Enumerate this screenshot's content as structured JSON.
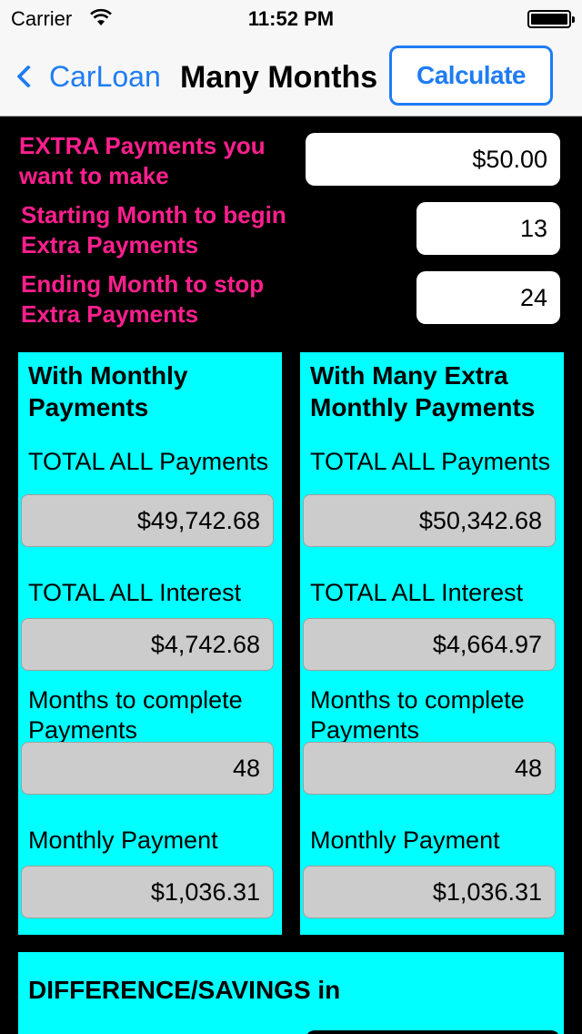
{
  "status_bar": {
    "carrier": "Carrier",
    "time": "11:52 PM",
    "icons": [
      "wifi-icon",
      "battery-icon"
    ]
  },
  "nav": {
    "back_label": "CarLoan",
    "title": "Many Months",
    "calculate_label": "Calculate",
    "accent_color": "#1f7cf3"
  },
  "inputs": {
    "extra_payment": {
      "label": "EXTRA Payments you want to make",
      "value": "$50.00"
    },
    "start_month": {
      "label": "Starting Month to begin Extra Payments",
      "value": "13"
    },
    "end_month": {
      "label": "Ending Month to stop Extra Payments",
      "value": "24"
    },
    "label_color": "#ff1f8e"
  },
  "panels": {
    "monthly": {
      "heading": "With Monthly Payments",
      "total_payments_label": "TOTAL ALL Payments",
      "total_payments_value": "$49,742.68",
      "total_interest_label": "TOTAL ALL Interest",
      "total_interest_value": "$4,742.68",
      "months_label": "Months to complete Payments",
      "months_value": "48",
      "monthly_payment_label": "Monthly Payment",
      "monthly_payment_value": "$1,036.31"
    },
    "extra": {
      "heading": "With Many Extra Monthly Payments",
      "total_payments_label": "TOTAL ALL Payments",
      "total_payments_value": "$50,342.68",
      "total_interest_label": "TOTAL ALL Interest",
      "total_interest_value": "$4,664.97",
      "months_label": "Months to complete Payments",
      "months_value": "48",
      "monthly_payment_label": "Monthly Payment",
      "monthly_payment_value": "$1,036.31"
    },
    "panel_color": "#00ffff"
  },
  "difference": {
    "heading": "DIFFERENCE/SAVINGS in"
  }
}
